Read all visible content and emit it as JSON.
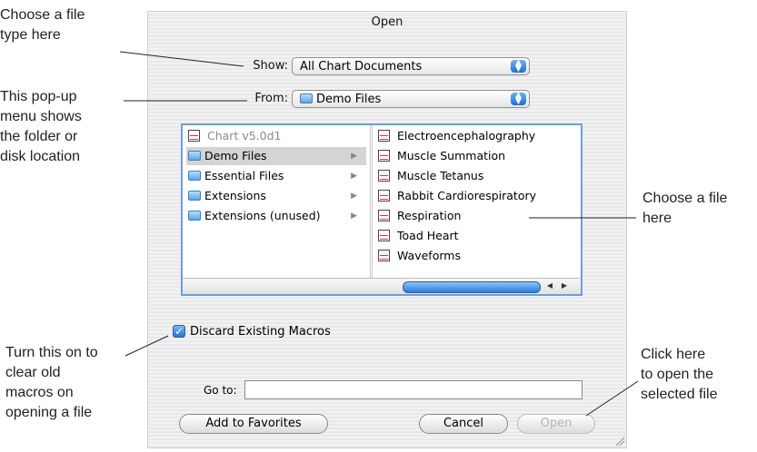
{
  "annotations": {
    "file_type": [
      "Choose a file",
      "type here"
    ],
    "folder": [
      "This pop-up",
      "menu shows",
      "the folder or",
      "disk location"
    ],
    "choose_file": [
      "Choose a file",
      "here"
    ],
    "discard": [
      "Turn this on to",
      "clear old",
      "macros on",
      "opening a file"
    ],
    "open": [
      "Click here",
      "to open the",
      "selected file"
    ]
  },
  "dialog": {
    "title": "Open",
    "show": {
      "label": "Show:",
      "value": "All Chart Documents"
    },
    "from": {
      "label": "From:",
      "value": "Demo Files",
      "icon": "folder-icon"
    },
    "column1": [
      {
        "label": "Chart v5.0d1",
        "icon": "app-icon",
        "state": "dim"
      },
      {
        "label": "Demo Files",
        "icon": "folder-icon",
        "state": "selected",
        "has_children": true
      },
      {
        "label": "Essential Files",
        "icon": "folder-icon",
        "has_children": true
      },
      {
        "label": "Extensions",
        "icon": "folder-icon",
        "has_children": true
      },
      {
        "label": "Extensions (unused)",
        "icon": "folder-icon",
        "has_children": true
      }
    ],
    "column2": [
      {
        "label": "Electroencephalography",
        "icon": "chart-document-icon"
      },
      {
        "label": "Muscle Summation",
        "icon": "chart-document-icon"
      },
      {
        "label": "Muscle Tetanus",
        "icon": "chart-document-icon"
      },
      {
        "label": "Rabbit Cardiorespiratory",
        "icon": "chart-document-icon"
      },
      {
        "label": "Respiration",
        "icon": "chart-document-icon"
      },
      {
        "label": "Toad Heart",
        "icon": "chart-document-icon"
      },
      {
        "label": "Waveforms",
        "icon": "chart-document-icon"
      }
    ],
    "discard_macros": {
      "label": "Discard Existing Macros",
      "checked": true
    },
    "goto": {
      "label": "Go to:",
      "value": ""
    },
    "buttons": {
      "add_favorites": "Add to Favorites",
      "cancel": "Cancel",
      "open": "Open"
    },
    "colors": {
      "accent": "#2a72d0",
      "selection": "#d4d4d4"
    }
  }
}
